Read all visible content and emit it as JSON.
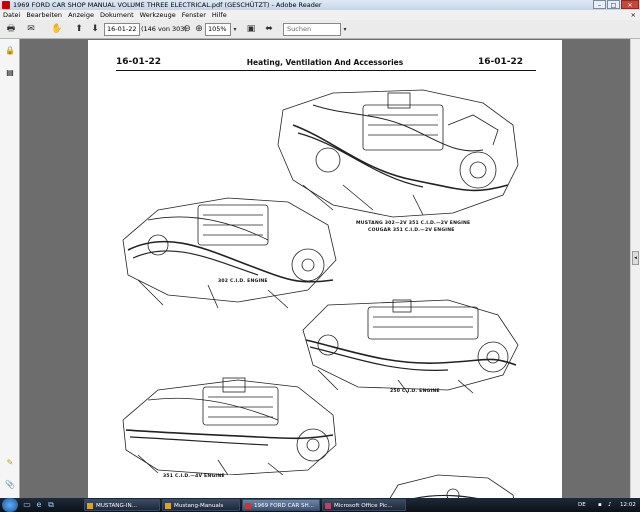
{
  "window": {
    "title": "1969 FORD CAR SHOP MANUAL VOLUME THREE ELECTRICAL.pdf (GESCHÜTZT) - Adobe Reader",
    "buttons": {
      "minimize": "–",
      "maximize": "□",
      "close": "✕"
    }
  },
  "menu": {
    "items": [
      "Datei",
      "Bearbeiten",
      "Anzeige",
      "Dokument",
      "Werkzeuge",
      "Fenster",
      "Hilfe"
    ],
    "close_glyph": "×"
  },
  "toolbar": {
    "page_value": "16-01-22",
    "page_count": "(146 von 303)",
    "zoom_value": "105%",
    "search_placeholder": "Suchen"
  },
  "document": {
    "page_number_left": "16-01-22",
    "page_number_right": "16-01-22",
    "section_title": "Heating, Ventilation And Accessories",
    "captions": {
      "mustang_line1": "MUSTANG 302—2V 351 C.I.D.—2V ENGINE",
      "mustang_line2": "COUGAR 351 C.I.D.—2V ENGINE",
      "engine_302": "302 C.I.D. ENGINE",
      "engine_250": "250 C.I.D. ENGINE",
      "engine_351_4v": "351 C.I.D.—4V ENGINE"
    }
  },
  "taskbar": {
    "tasks": [
      {
        "label": "MUSTANG-IN...",
        "active": false
      },
      {
        "label": "Mustang-Manuals",
        "active": false
      },
      {
        "label": "1969 FORD CAR SH...",
        "active": true
      },
      {
        "label": "Microsoft Office Pic...",
        "active": false
      }
    ],
    "language": "DE",
    "clock": "12:02"
  },
  "colors": {
    "accent": "#c00000",
    "taskbar": "#0b1119",
    "viewer_bg": "#6d6d6d"
  }
}
